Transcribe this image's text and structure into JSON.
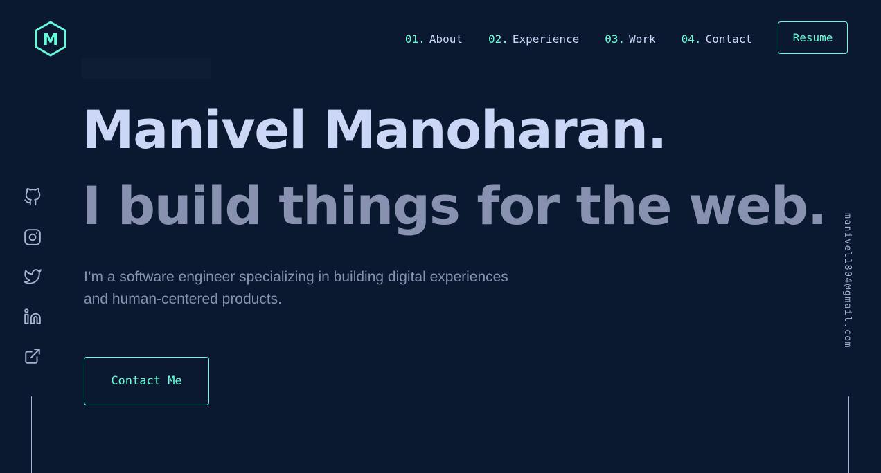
{
  "logo": {
    "letter": "M",
    "icon": "hexagon-logo-icon"
  },
  "nav": {
    "items": [
      {
        "num": "01.",
        "label": "About"
      },
      {
        "num": "02.",
        "label": "Experience"
      },
      {
        "num": "03.",
        "label": "Work"
      },
      {
        "num": "04.",
        "label": "Contact"
      }
    ],
    "resume_label": "Resume"
  },
  "hero": {
    "name": "Manivel Manoharan.",
    "tagline": "I build things for the web.",
    "description": "I’m a software engineer specializing in building digital experiences and human-centered products.",
    "cta_label": "Contact Me"
  },
  "social": {
    "icons": [
      "github-icon",
      "instagram-icon",
      "twitter-icon",
      "linkedin-icon",
      "external-link-icon"
    ]
  },
  "email": "manivel1804@gmail.com",
  "colors": {
    "background": "#0b1930",
    "accent": "#64ffda",
    "heading": "#ccd6f6",
    "muted": "#8892b0"
  }
}
